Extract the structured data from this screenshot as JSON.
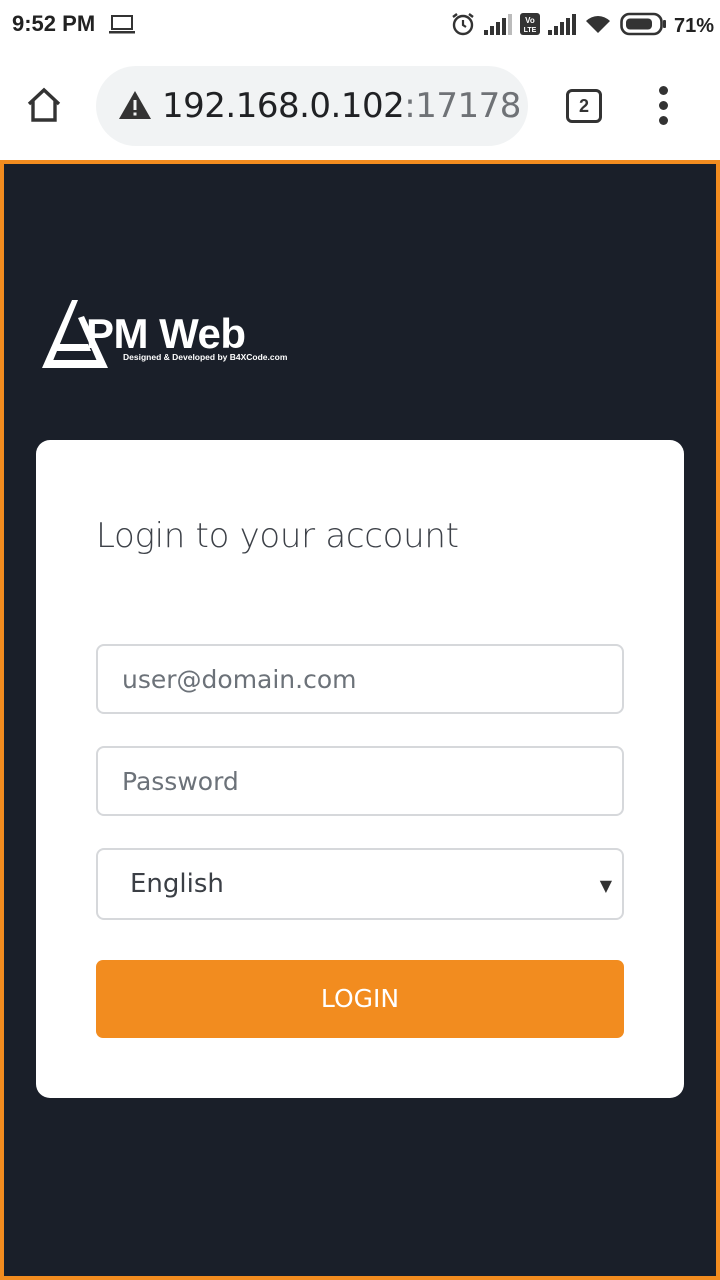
{
  "status_bar": {
    "time": "9:52 PM",
    "battery_percent": "71%",
    "icons": [
      "laptop-icon",
      "alarm-icon",
      "signal-icon",
      "volte-icon",
      "signal-icon",
      "wifi-icon",
      "battery-icon"
    ]
  },
  "browser": {
    "url_host": "192.168.0.102",
    "url_port": ":17178",
    "tab_count": "2"
  },
  "brand": {
    "title": "PM Web",
    "subtitle": "Designed & Developed by B4XCode.com"
  },
  "login": {
    "heading": "Login to your account",
    "email_placeholder": "user@domain.com",
    "password_placeholder": "Password",
    "language_selected": "English",
    "button_label": "LOGIN"
  },
  "colors": {
    "accent": "#f28c1f",
    "page_background": "#1a1f29",
    "card_background": "#ffffff"
  }
}
